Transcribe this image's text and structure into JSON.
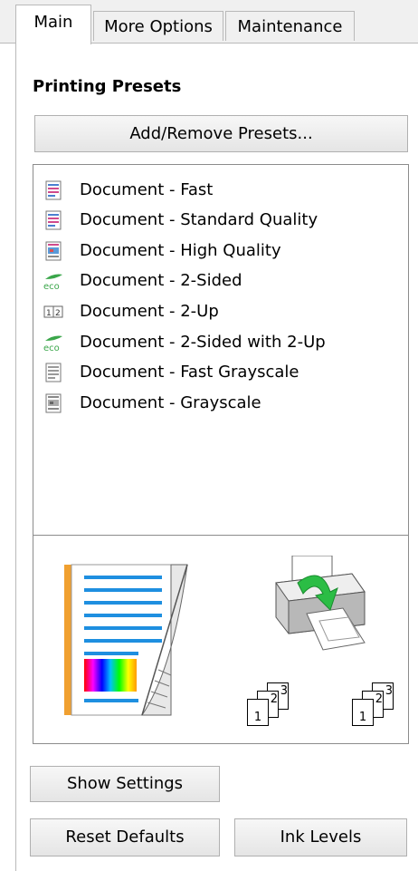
{
  "tabs": [
    {
      "label": "Main",
      "active": true
    },
    {
      "label": "More Options",
      "active": false
    },
    {
      "label": "Maintenance",
      "active": false
    }
  ],
  "printing_presets": {
    "title": "Printing Presets",
    "add_remove_label": "Add/Remove Presets...",
    "items": [
      {
        "label": "Document - Fast",
        "icon": "color-document-icon"
      },
      {
        "label": "Document - Standard Quality",
        "icon": "color-document-icon"
      },
      {
        "label": "Document - High Quality",
        "icon": "color-photo-document-icon"
      },
      {
        "label": "Document - 2-Sided",
        "icon": "eco-icon"
      },
      {
        "label": "Document - 2-Up",
        "icon": "two-up-icon"
      },
      {
        "label": "Document - 2-Sided with 2-Up",
        "icon": "eco-icon"
      },
      {
        "label": "Document - Fast Grayscale",
        "icon": "grayscale-document-icon"
      },
      {
        "label": "Document - Grayscale",
        "icon": "grayscale-photo-document-icon"
      }
    ]
  },
  "preview": {
    "collate_order_a": [
      "1",
      "2",
      "3"
    ],
    "collate_order_b": [
      "1",
      "2",
      "3"
    ],
    "colors": {
      "accent_blue": "#1e8fe0",
      "orange": "#f0a030",
      "printer_green": "#2bbd45"
    }
  },
  "buttons": {
    "show_settings": "Show Settings",
    "reset_defaults": "Reset Defaults",
    "ink_levels": "Ink Levels"
  }
}
